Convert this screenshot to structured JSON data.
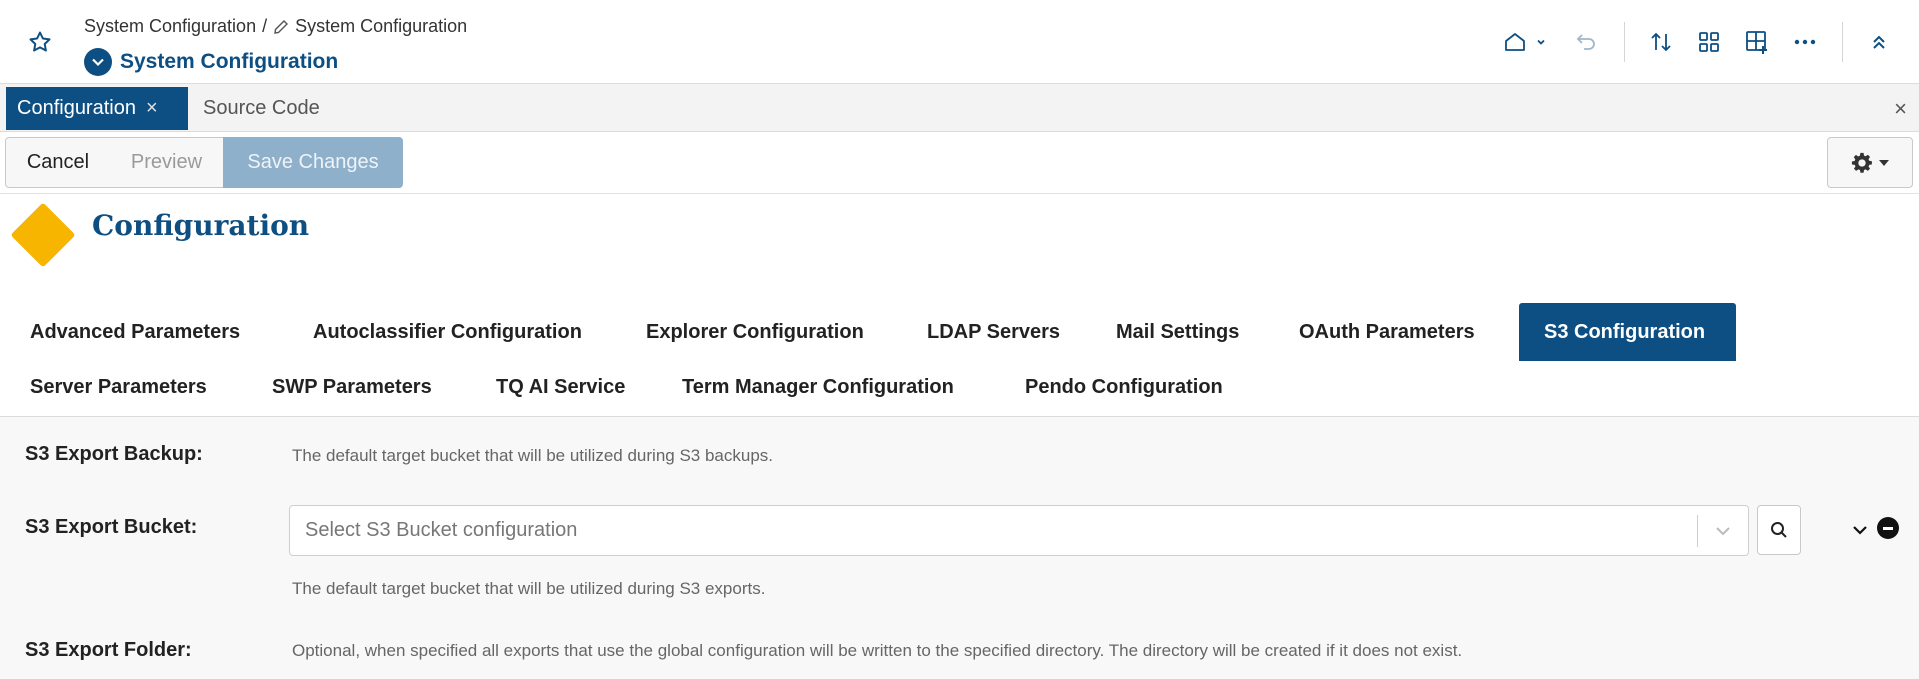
{
  "header": {
    "breadcrumb_parent": "System Configuration",
    "breadcrumb_separator": "/",
    "breadcrumb_current": "System Configuration",
    "title": "System Configuration"
  },
  "doc_tabs": {
    "active_label": "Configuration",
    "active_close": "×",
    "other_label": "Source Code",
    "close_all": "×"
  },
  "toolbar": {
    "cancel_label": "Cancel",
    "preview_label": "Preview",
    "save_label": "Save Changes"
  },
  "page": {
    "heading": "Configuration"
  },
  "section_tabs": [
    {
      "label": "Advanced Parameters",
      "active": false
    },
    {
      "label": "Autoclassifier Configuration",
      "active": false
    },
    {
      "label": "Explorer Configuration",
      "active": false
    },
    {
      "label": "LDAP Servers",
      "active": false
    },
    {
      "label": "Mail Settings",
      "active": false
    },
    {
      "label": "OAuth Parameters",
      "active": false
    },
    {
      "label": "S3 Configuration",
      "active": true
    },
    {
      "label": "Server Parameters",
      "active": false
    },
    {
      "label": "SWP Parameters",
      "active": false
    },
    {
      "label": "TQ AI Service",
      "active": false
    },
    {
      "label": "Term Manager Configuration",
      "active": false
    },
    {
      "label": "Pendo Configuration",
      "active": false
    }
  ],
  "fields": {
    "export_backup": {
      "label": "S3 Export Backup:",
      "description": "The default target bucket that will be utilized during S3 backups."
    },
    "export_bucket": {
      "label": "S3 Export Bucket:",
      "placeholder": "Select S3 Bucket configuration",
      "description": "The default target bucket that will be utilized during S3 exports."
    },
    "export_folder": {
      "label": "S3 Export Folder:",
      "description": "Optional, when specified all exports that use the global configuration will be written to the specified directory. The directory will be created if it does not exist."
    }
  },
  "colors": {
    "brand": "#0d4f82",
    "accent": "#f7b500",
    "save_disabled": "#8fb0cb"
  },
  "icons": [
    "star-icon",
    "pencil-icon",
    "chevron-down-icon",
    "home-icon",
    "undo-icon",
    "sort-icon",
    "grid-icon",
    "add-widget-icon",
    "more-icon",
    "collapse-icon",
    "close-icon",
    "gear-icon",
    "search-icon",
    "minus-icon"
  ]
}
